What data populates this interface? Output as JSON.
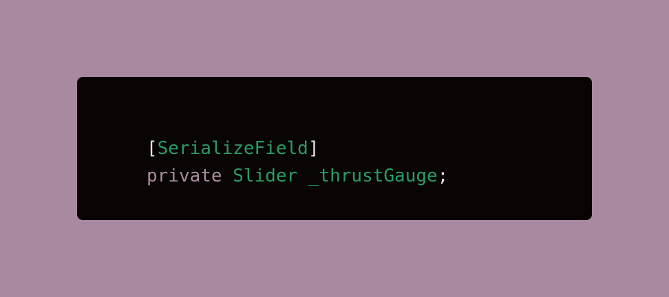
{
  "colors": {
    "page_background": "#a9899f",
    "card_background": "#080404",
    "punctuation": "#ece2e6",
    "type_identifier": "#2a9d63",
    "keyword": "#a98c9f"
  },
  "code": {
    "line1": {
      "open_bracket": "[",
      "attribute": "SerializeField",
      "close_bracket": "]"
    },
    "line2": {
      "keyword": "private",
      "space1": " ",
      "type": "Slider",
      "space2": " ",
      "identifier": "_thrustGauge",
      "semicolon": ";"
    }
  }
}
